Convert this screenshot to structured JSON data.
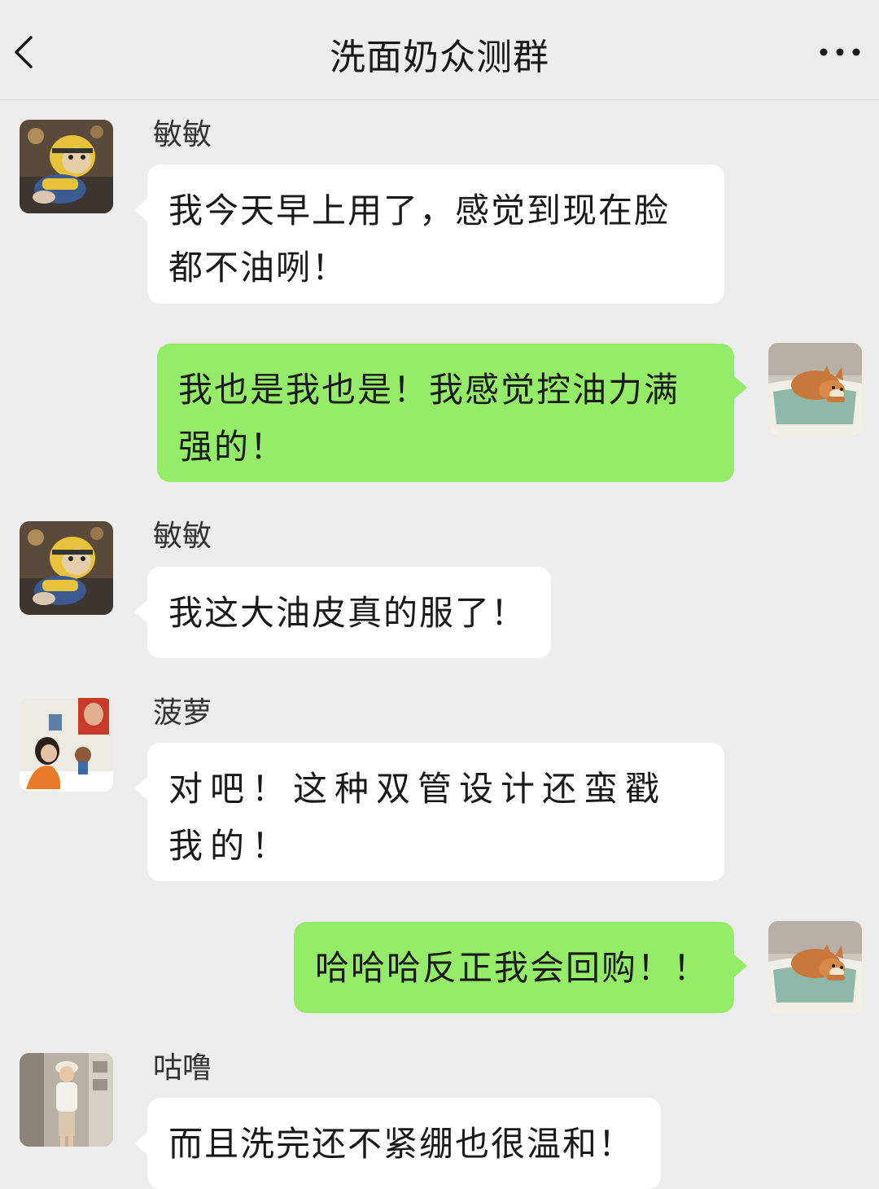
{
  "header": {
    "title": "洗面奶众测群"
  },
  "messages": [
    {
      "sender": "敏敏",
      "text": "我今天早上用了，感觉到现在脸都不油咧！"
    },
    {
      "text": "我也是我也是！我感觉控油力满强的！"
    },
    {
      "sender": "敏敏",
      "text": "我这大油皮真的服了！"
    },
    {
      "sender": "菠萝",
      "text": "对吧！这种双管设计还蛮戳我的！"
    },
    {
      "text": "哈哈哈反正我会回购！！"
    },
    {
      "sender": "咕噜",
      "text": "而且洗完还不紧绷也很温和！"
    }
  ],
  "colors": {
    "self_bubble": "#95EC69",
    "other_bubble": "#FFFFFF",
    "background": "#EDEDED"
  }
}
